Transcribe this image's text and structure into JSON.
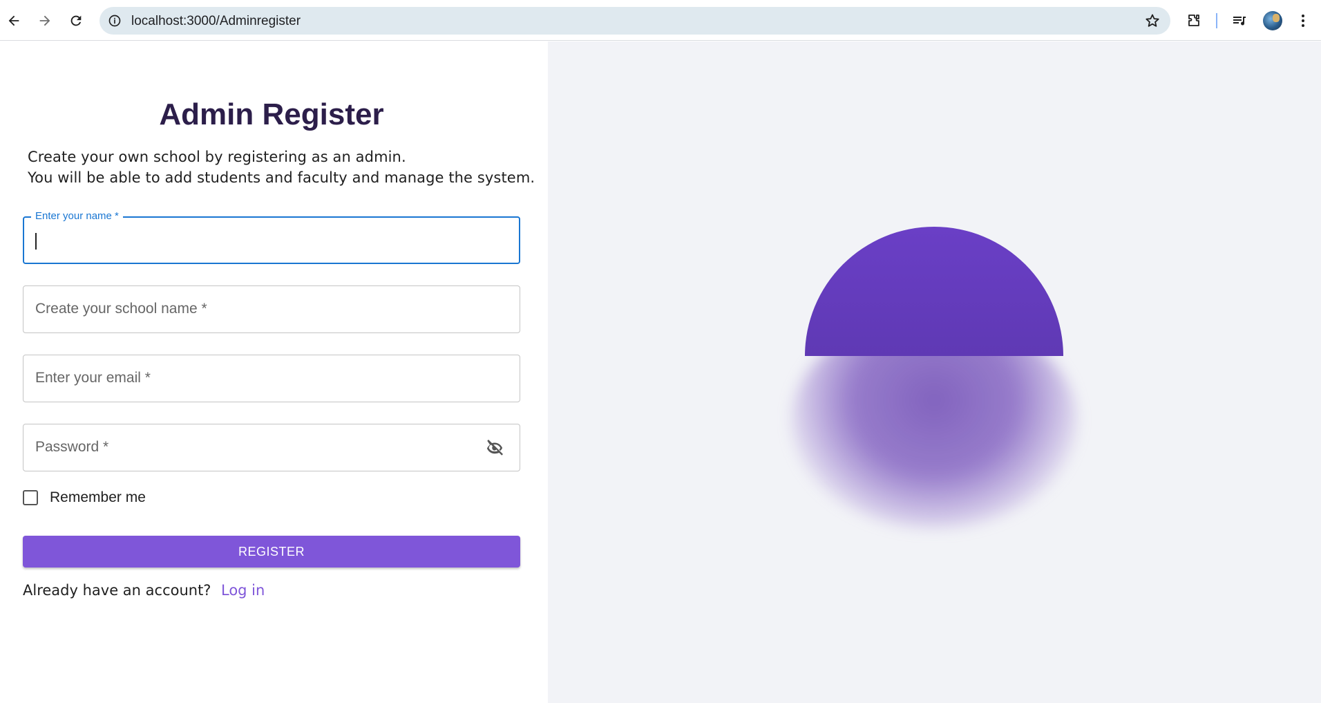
{
  "browser": {
    "url": "localhost:3000/Adminregister",
    "icons": [
      "back-arrow-icon",
      "forward-arrow-icon",
      "reload-icon",
      "info-icon",
      "star-icon",
      "extensions-icon",
      "media-icon",
      "profile-avatar",
      "more-vert-icon"
    ]
  },
  "form": {
    "title": "Admin Register",
    "subtitle_line1": "Create your own school by registering as an admin.",
    "subtitle_line2": "You will be able to add students and faculty and manage the system.",
    "name_label": "Enter your name *",
    "name_value": "",
    "school_placeholder": "Create your school name *",
    "email_placeholder": "Enter your email *",
    "password_placeholder": "Password *",
    "remember_label": "Remember me",
    "remember_checked": false,
    "register_label": "REGISTER",
    "account_text": "Already have an account?",
    "login_label": "Log in"
  },
  "colors": {
    "accent": "#7f56d9",
    "focus": "#1976d2",
    "title": "#2c1e4a",
    "right_bg": "#f2f3f7",
    "orb": "#6a3fc6"
  }
}
